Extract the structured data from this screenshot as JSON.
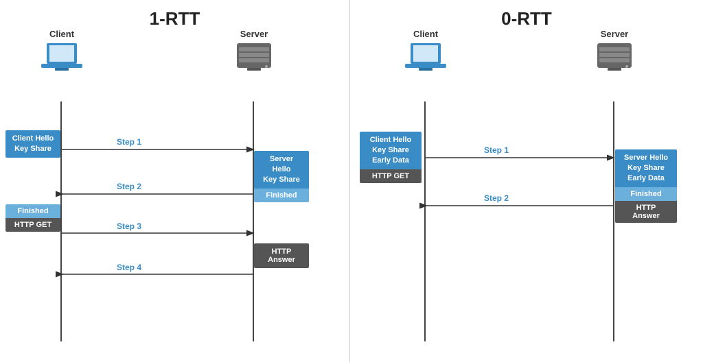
{
  "diagram": {
    "title_1rtt": "1-RTT",
    "title_0rtt": "0-RTT",
    "actors": {
      "rtt1_client": "Client",
      "rtt1_server": "Server",
      "rtt0_client": "Client",
      "rtt0_server": "Server"
    },
    "rtt1": {
      "client_msg1_line1": "Client Hello",
      "client_msg1_line2": "Key Share",
      "server_msg1_line1": "Server Hello",
      "server_msg1_line2": "Key Share",
      "server_msg2": "Finished",
      "client_msg2": "Finished",
      "client_msg3": "HTTP GET",
      "server_msg3_line1": "HTTP",
      "server_msg3_line2": "Answer",
      "step1": "Step 1",
      "step2": "Step 2",
      "step3": "Step 3",
      "step4": "Step 4"
    },
    "rtt0": {
      "client_msg1_line1": "Client Hello",
      "client_msg1_line2": "Key Share",
      "client_msg1_line3": "Early Data",
      "client_msg2": "HTTP GET",
      "server_msg1_line1": "Server Hello",
      "server_msg1_line2": "Key Share",
      "server_msg1_line3": "Early Data",
      "server_msg2": "Finished",
      "server_msg3_line1": "HTTP",
      "server_msg3_line2": "Answer",
      "step1": "Step 1",
      "step2": "Step 2"
    }
  }
}
